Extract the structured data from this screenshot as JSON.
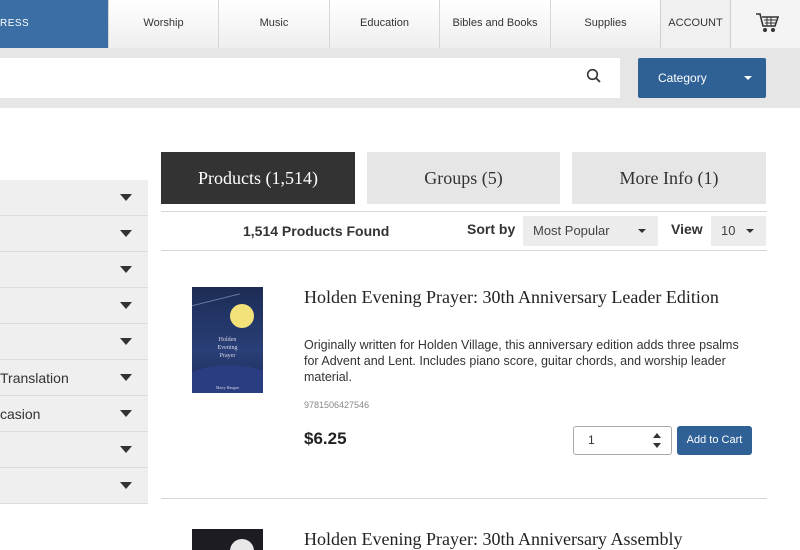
{
  "nav": {
    "brand_label": "RESS",
    "items": [
      "Worship",
      "Music",
      "Education",
      "Bibles and Books",
      "Supplies"
    ],
    "account_label": "ACCOUNT",
    "cart_icon": "shopping-cart-icon"
  },
  "search": {
    "value": "",
    "icon": "search-icon",
    "category_label": "Category"
  },
  "sidebar": {
    "filters": [
      "",
      "",
      "",
      "",
      "",
      "Translation",
      "casion",
      "",
      ""
    ]
  },
  "tabs": [
    {
      "label": "Products (1,514)",
      "active": true
    },
    {
      "label": "Groups (5)",
      "active": false
    },
    {
      "label": "More Info (1)",
      "active": false
    }
  ],
  "results": {
    "found_label": "1,514 Products Found",
    "sort_label": "Sort by",
    "sort_value": "Most Popular",
    "view_label": "View",
    "view_value": "10"
  },
  "products": [
    {
      "title": "Holden Evening Prayer: 30th Anniversary Leader Edition",
      "description": "Originally written for Holden Village, this anniversary edition adds three psalms for Advent and Lent. Includes piano score, guitar chords, and worship leader material.",
      "isbn": "9781506427546",
      "price": "$6.25",
      "quantity": "1",
      "add_label": "Add to Cart",
      "cover_text": {
        "title1": "Holden",
        "title2": "Evening",
        "title3": "Prayer",
        "author": "Marty Haugen"
      }
    },
    {
      "title": "Holden Evening Prayer: 30th Anniversary Assembly"
    }
  ],
  "colors": {
    "brand_blue": "#3b6ea5",
    "button_blue": "#2f6196",
    "active_tab": "#333333"
  }
}
